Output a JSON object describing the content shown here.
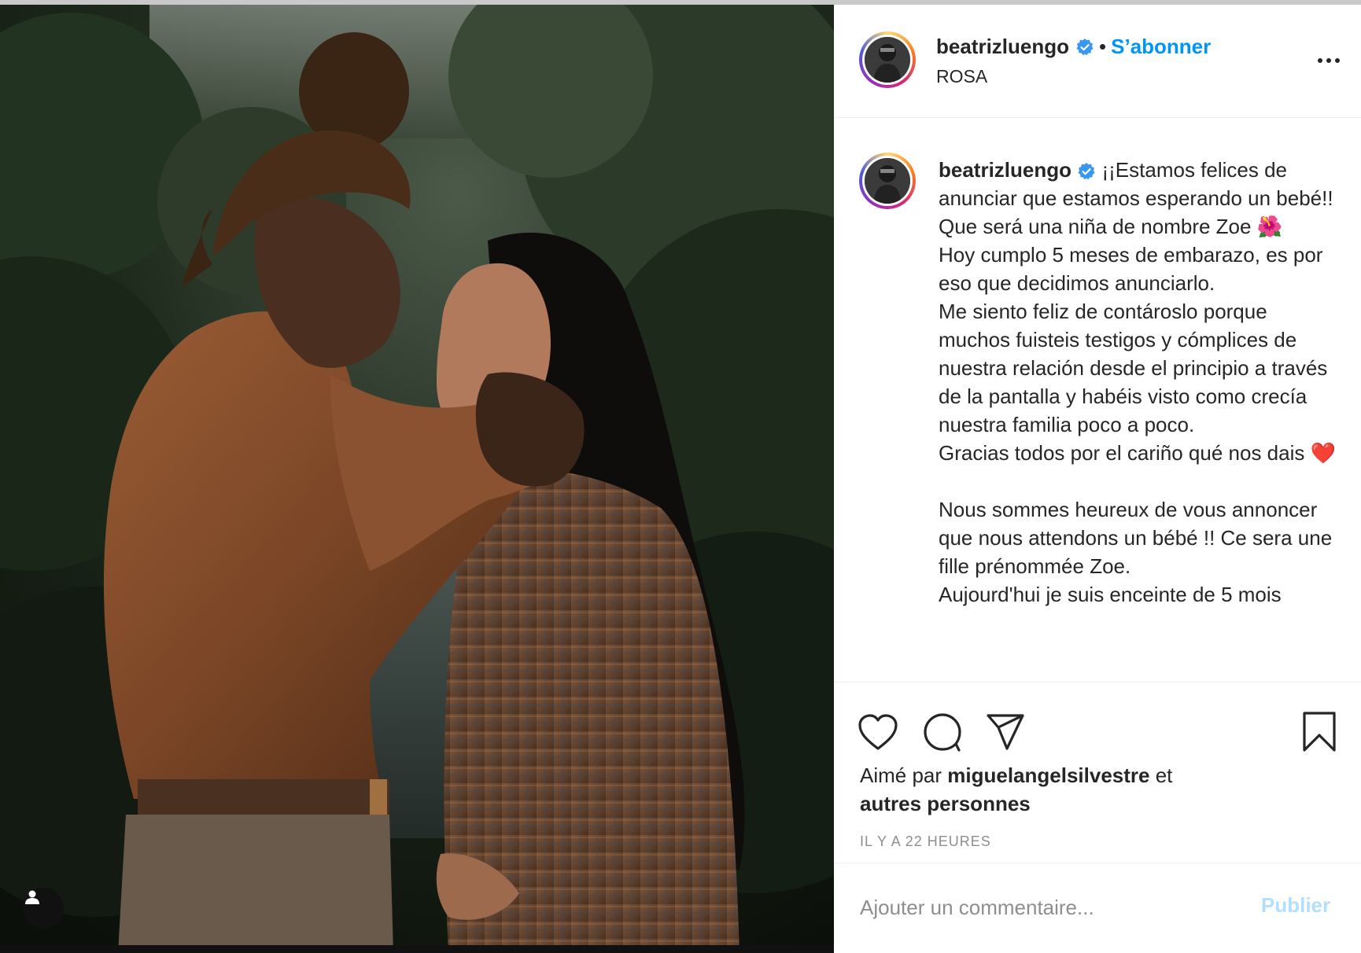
{
  "post": {
    "username": "beatrizluengo",
    "follow_label": "S’abonner",
    "separator": "•",
    "location": "ROSA"
  },
  "caption": {
    "username": "beatrizluengo",
    "spanish_1": "¡¡Estamos felices de anunciar que estamos esperando un bebé!! Que será una niña de nombre Zoe 🌺",
    "spanish_2": "Hoy cumplo 5 meses de embarazo, es por eso que decidimos anunciarlo.",
    "spanish_3": "Me siento feliz de contároslo porque muchos fuisteis testigos y cómplices de nuestra relación desde el principio a través de la pantalla y habéis visto como crecía nuestra familia poco a poco.",
    "spanish_4": "Gracias todos por el cariño qué nos dais ❤️",
    "french_1": "Nous sommes heureux de vous annoncer que nous attendons un bébé !! Ce sera une fille prénommée Zoe.",
    "french_2": "Aujourd'hui je suis enceinte de 5 mois"
  },
  "engagement": {
    "liked_prefix": "Aimé par ",
    "liked_user": "miguelangelsilvestre",
    "liked_conj": " et",
    "liked_others": "autres personnes",
    "timestamp": "IL Y A 22 HEURES"
  },
  "comment": {
    "placeholder": "Ajouter un commentaire...",
    "publish_label": "Publier"
  },
  "icons": {
    "more": "more-dots-icon",
    "verified": "verified-badge-icon",
    "like": "heart-icon",
    "comment": "comment-bubble-icon",
    "share": "paper-plane-icon",
    "save": "bookmark-icon",
    "user": "user-tag-icon"
  },
  "colors": {
    "link_blue": "#0095f6",
    "publish_disabled": "#b2dffc",
    "muted_gray": "#8e8e8e",
    "text": "#262626"
  }
}
